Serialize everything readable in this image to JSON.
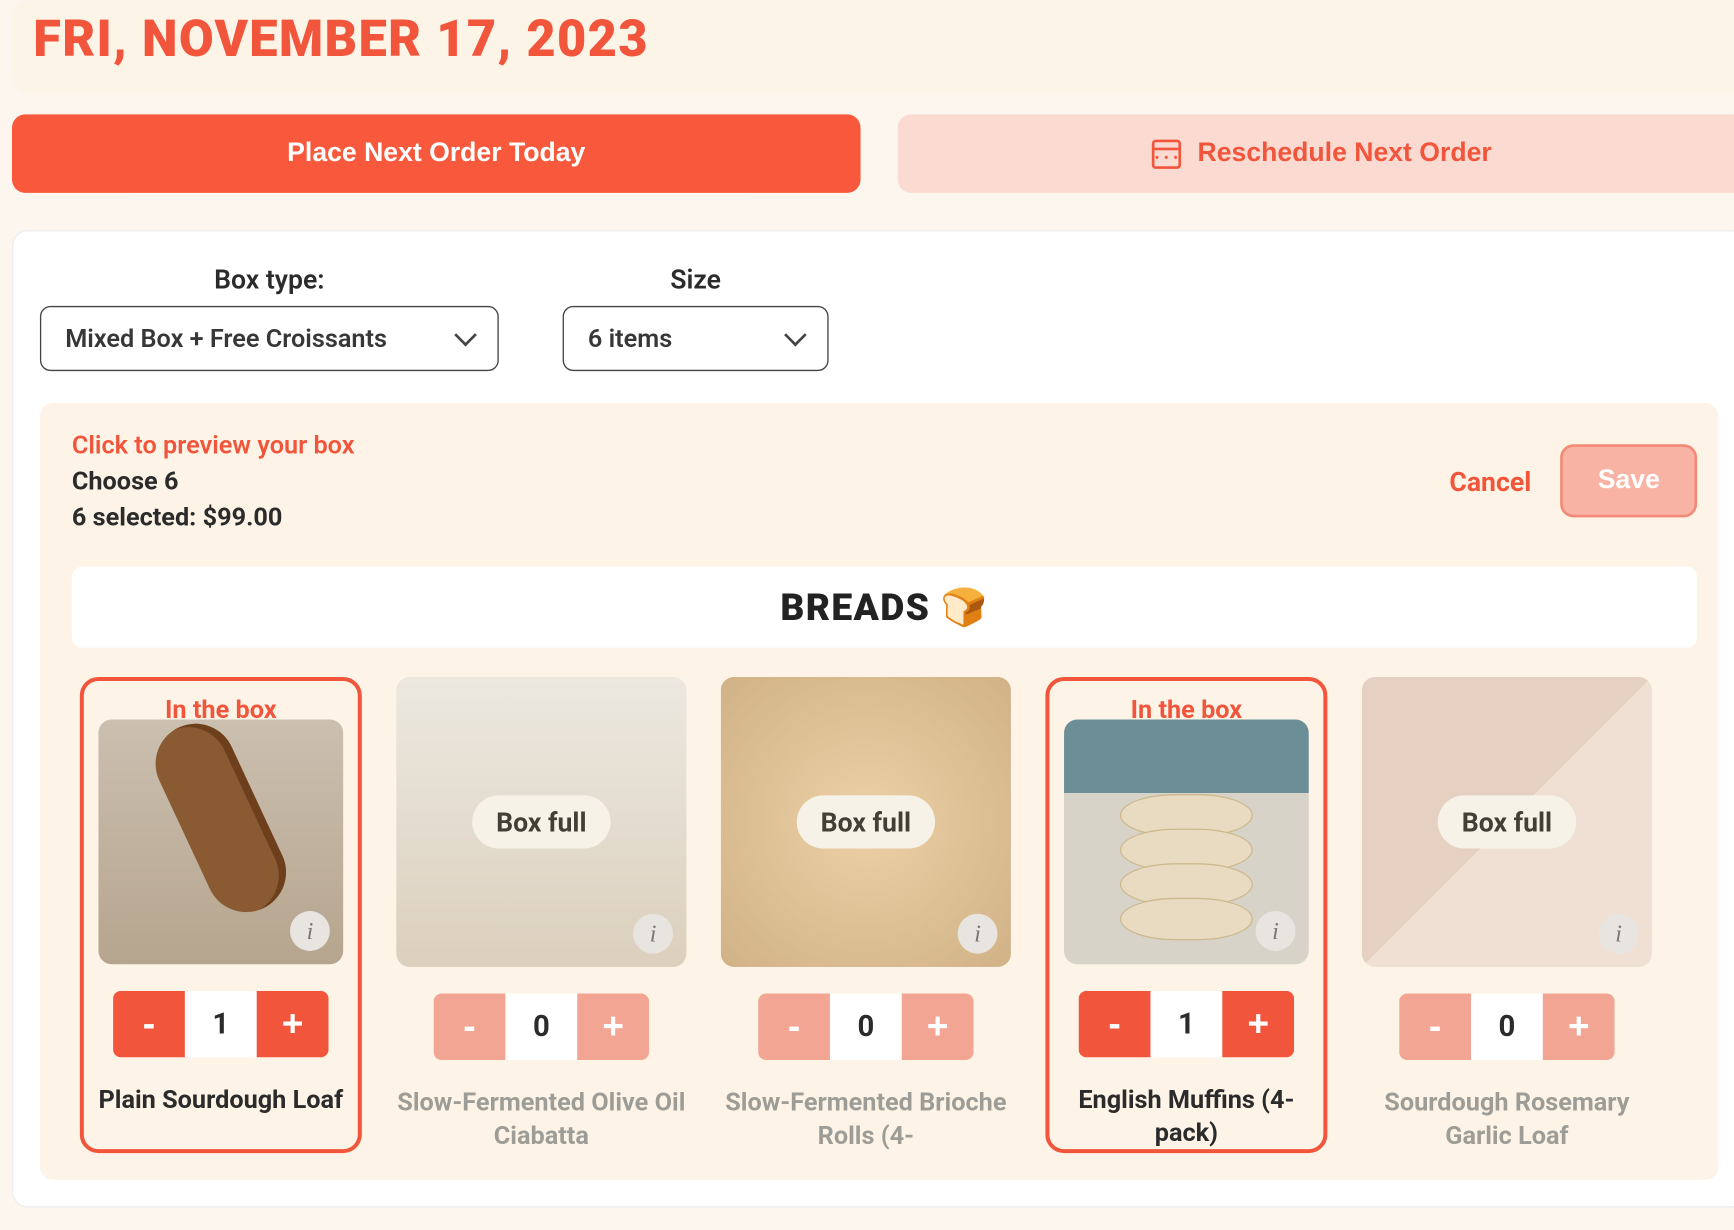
{
  "date_heading": "FRI, NOVEMBER 17, 2023",
  "actions": {
    "place_order": "Place Next Order Today",
    "reschedule": "Reschedule Next Order"
  },
  "selectors": {
    "box_type_label": "Box type:",
    "box_type_value": "Mixed Box + Free Croissants",
    "size_label": "Size",
    "size_value": "6 items"
  },
  "box": {
    "preview_link": "Click to preview your box",
    "choose_text": "Choose 6",
    "selected_text": "6 selected: $99.00",
    "cancel": "Cancel",
    "save": "Save"
  },
  "category": {
    "title": "BREADS",
    "emoji": "🍞"
  },
  "in_box_badge": "In the box",
  "box_full_badge": "Box full",
  "info_symbol": "i",
  "products": [
    {
      "name": "Plain Sourdough Loaf",
      "qty": "1",
      "in_box": true
    },
    {
      "name": "Slow-Fermented Olive Oil Ciabatta",
      "qty": "0",
      "in_box": false
    },
    {
      "name": "Slow-Fermented Brioche Rolls (4-",
      "qty": "0",
      "in_box": false
    },
    {
      "name": "English Muffins (4-pack)",
      "qty": "1",
      "in_box": true
    },
    {
      "name": "Sourdough Rosemary Garlic Loaf",
      "qty": "0",
      "in_box": false
    }
  ]
}
